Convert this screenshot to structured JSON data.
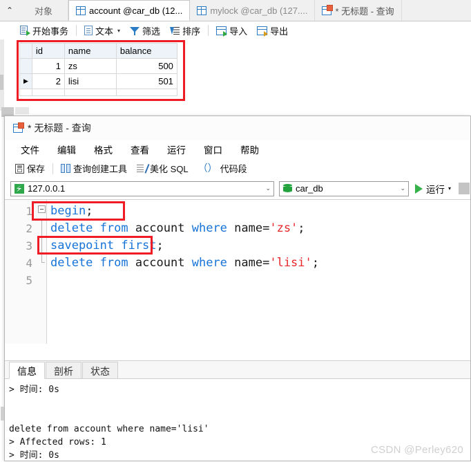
{
  "main_window": {
    "tabs": [
      {
        "label": "对象",
        "icon": "none",
        "state": "inactive"
      },
      {
        "label": "account @car_db (12...",
        "icon": "table-grid-icon",
        "state": "active"
      },
      {
        "label": "mylock @car_db (127....",
        "icon": "table-grid-icon",
        "state": "inactive"
      },
      {
        "label": "* 无标题 - 查询",
        "icon": "query-icon",
        "state": "inactive"
      }
    ],
    "collapse_icon": "chevron-up-icon",
    "toolbar": [
      {
        "label": "开始事务",
        "icon": "begin-transaction-icon"
      },
      {
        "label": "文本",
        "icon": "text-icon",
        "caret": "▾"
      },
      {
        "label": "筛选",
        "icon": "filter-icon"
      },
      {
        "label": "排序",
        "icon": "sort-icon"
      },
      {
        "label": "导入",
        "icon": "import-icon"
      },
      {
        "label": "导出",
        "icon": "export-icon"
      }
    ],
    "grid": {
      "columns": [
        "id",
        "name",
        "balance"
      ],
      "rows": [
        {
          "marker": "",
          "id": "1",
          "name": "zs",
          "balance": "500"
        },
        {
          "marker": "▶",
          "id": "2",
          "name": "lisi",
          "balance": "501"
        }
      ]
    }
  },
  "query_window": {
    "title": "* 无标题 - 查询",
    "title_icon": "query-window-icon",
    "menu": [
      "文件",
      "编辑",
      "格式",
      "查看",
      "运行",
      "窗口",
      "帮助"
    ],
    "toolbar": [
      {
        "label": "保存",
        "icon": "save-icon"
      },
      {
        "label": "查询创建工具",
        "icon": "query-builder-icon"
      },
      {
        "label": "美化 SQL",
        "icon": "beautify-sql-icon"
      },
      {
        "label": "代码段",
        "icon": "snippet-icon"
      }
    ],
    "connection": {
      "host_value": "127.0.0.1",
      "host_icon": "connection-icon",
      "db_value": "car_db",
      "db_icon": "database-icon",
      "run_label": "运行",
      "run_icon": "play-icon",
      "run_caret": "▾",
      "stop_icon": "stop-button"
    },
    "editor": {
      "lines": [
        {
          "num": "1",
          "fold": "start",
          "tokens": [
            {
              "t": "begin",
              "c": "kw"
            },
            {
              "t": ";",
              "c": "op"
            }
          ]
        },
        {
          "num": "2",
          "fold": "mid",
          "tokens": [
            {
              "t": "delete from ",
              "c": "kw"
            },
            {
              "t": "account ",
              "c": "id"
            },
            {
              "t": "where ",
              "c": "kw"
            },
            {
              "t": "name",
              "c": "id"
            },
            {
              "t": "=",
              "c": "op"
            },
            {
              "t": "'zs'",
              "c": "str"
            },
            {
              "t": ";",
              "c": "op"
            }
          ]
        },
        {
          "num": "3",
          "fold": "mid",
          "tokens": [
            {
              "t": "savepoint first",
              "c": "kw"
            },
            {
              "t": ";",
              "c": "op"
            }
          ]
        },
        {
          "num": "4",
          "fold": "end",
          "tokens": [
            {
              "t": "delete from ",
              "c": "kw"
            },
            {
              "t": "account ",
              "c": "id"
            },
            {
              "t": "where ",
              "c": "kw"
            },
            {
              "t": "name",
              "c": "id"
            },
            {
              "t": "=",
              "c": "op"
            },
            {
              "t": "'lisi'",
              "c": "str"
            },
            {
              "t": ";",
              "c": "op"
            }
          ]
        },
        {
          "num": "5",
          "fold": "none",
          "tokens": []
        }
      ]
    },
    "result": {
      "tabs": [
        {
          "label": "信息",
          "active": true
        },
        {
          "label": "剖析",
          "active": false
        },
        {
          "label": "状态",
          "active": false
        }
      ],
      "output": [
        "> 时间: 0s",
        "",
        "",
        "delete from account where name='lisi'",
        "> Affected rows: 1",
        "> 时间: 0s"
      ]
    }
  },
  "annotations": {
    "highlight_color": "#ee1c25",
    "boxes": [
      "grid-result-highlight",
      "begin-statement-highlight",
      "savepoint-statement-highlight"
    ]
  },
  "watermark": "CSDN @Perley620"
}
